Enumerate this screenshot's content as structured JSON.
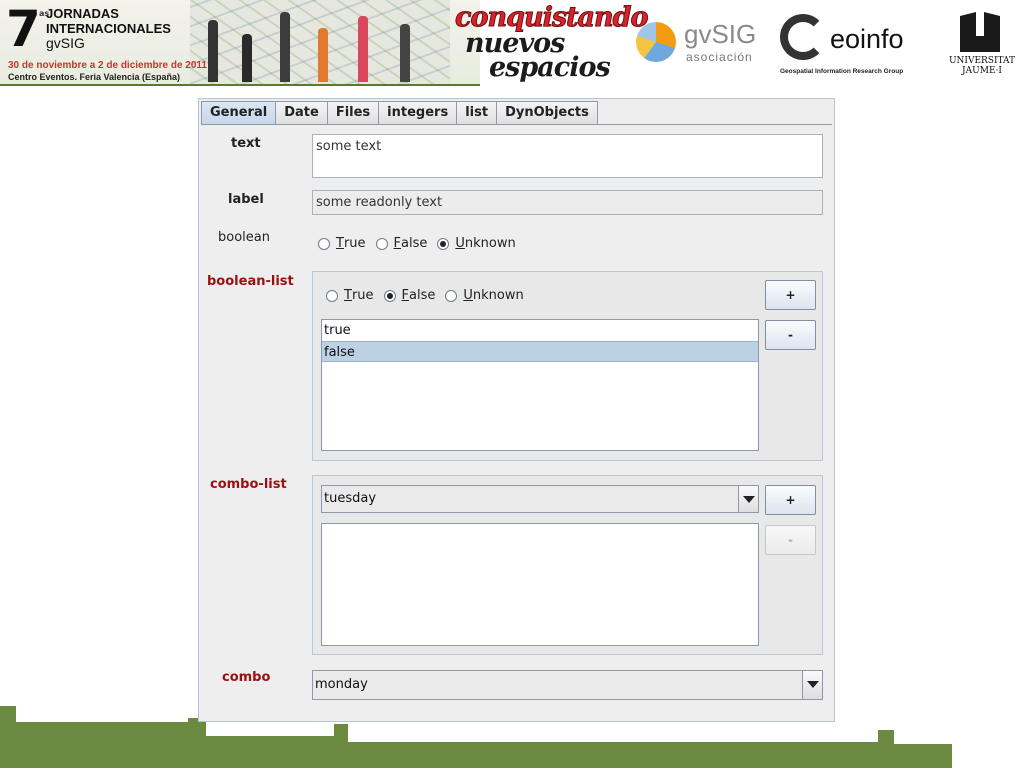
{
  "banner": {
    "event": {
      "number": "7",
      "edition": "as",
      "line1": "JORNADAS",
      "line2": "INTERNACIONALES",
      "line3": "gvSIG",
      "dates": "30 de noviembre a 2 de diciembre de 2011",
      "venue": "Centro Eventos. Feria Valencia (España)"
    },
    "slogan": [
      "conquistando",
      "nuevos",
      "espacios"
    ],
    "gvsig": {
      "name": "gvSIG",
      "sub": "asociación"
    },
    "geoinfo": {
      "name": "eoinfo",
      "sub": "Geospatial Information Research Group"
    },
    "uji": {
      "line1": "UNIVERSITAT",
      "line2": "JAUME·I"
    }
  },
  "dialog": {
    "tabs": [
      {
        "label": "General",
        "active": true
      },
      {
        "label": "Date",
        "active": false
      },
      {
        "label": "Files",
        "active": false
      },
      {
        "label": "integers",
        "active": false
      },
      {
        "label": "list",
        "active": false
      },
      {
        "label": "DynObjects",
        "active": false
      }
    ],
    "fields": {
      "text": {
        "label": "text",
        "value": "some text"
      },
      "label": {
        "label": "label",
        "value": "some readonly text"
      },
      "boolean": {
        "label": "boolean",
        "options": [
          {
            "label": "True",
            "mnemonic": "T",
            "rest": "rue",
            "selected": false
          },
          {
            "label": "False",
            "mnemonic": "F",
            "rest": "alse",
            "selected": false
          },
          {
            "label": "Unknown",
            "mnemonic": "U",
            "rest": "nknown",
            "selected": true
          }
        ]
      },
      "boolean_list": {
        "label": "boolean-list",
        "options": [
          {
            "label": "True",
            "mnemonic": "T",
            "rest": "rue",
            "selected": false
          },
          {
            "label": "False",
            "mnemonic": "F",
            "rest": "alse",
            "selected": true
          },
          {
            "label": "Unknown",
            "mnemonic": "U",
            "rest": "nknown",
            "selected": false
          }
        ],
        "items": [
          {
            "text": "true",
            "selected": false
          },
          {
            "text": "false",
            "selected": true
          }
        ],
        "add_label": "+",
        "remove_label": "-"
      },
      "combo_list": {
        "label": "combo-list",
        "selected": "tuesday",
        "items": [],
        "add_label": "+",
        "remove_label": "-",
        "remove_enabled": false
      },
      "combo": {
        "label": "combo",
        "selected": "monday"
      }
    }
  },
  "colors": {
    "required_label": "#9b1010",
    "selection": "#bcd0e6",
    "decoration_green": "#6c8a3f"
  }
}
